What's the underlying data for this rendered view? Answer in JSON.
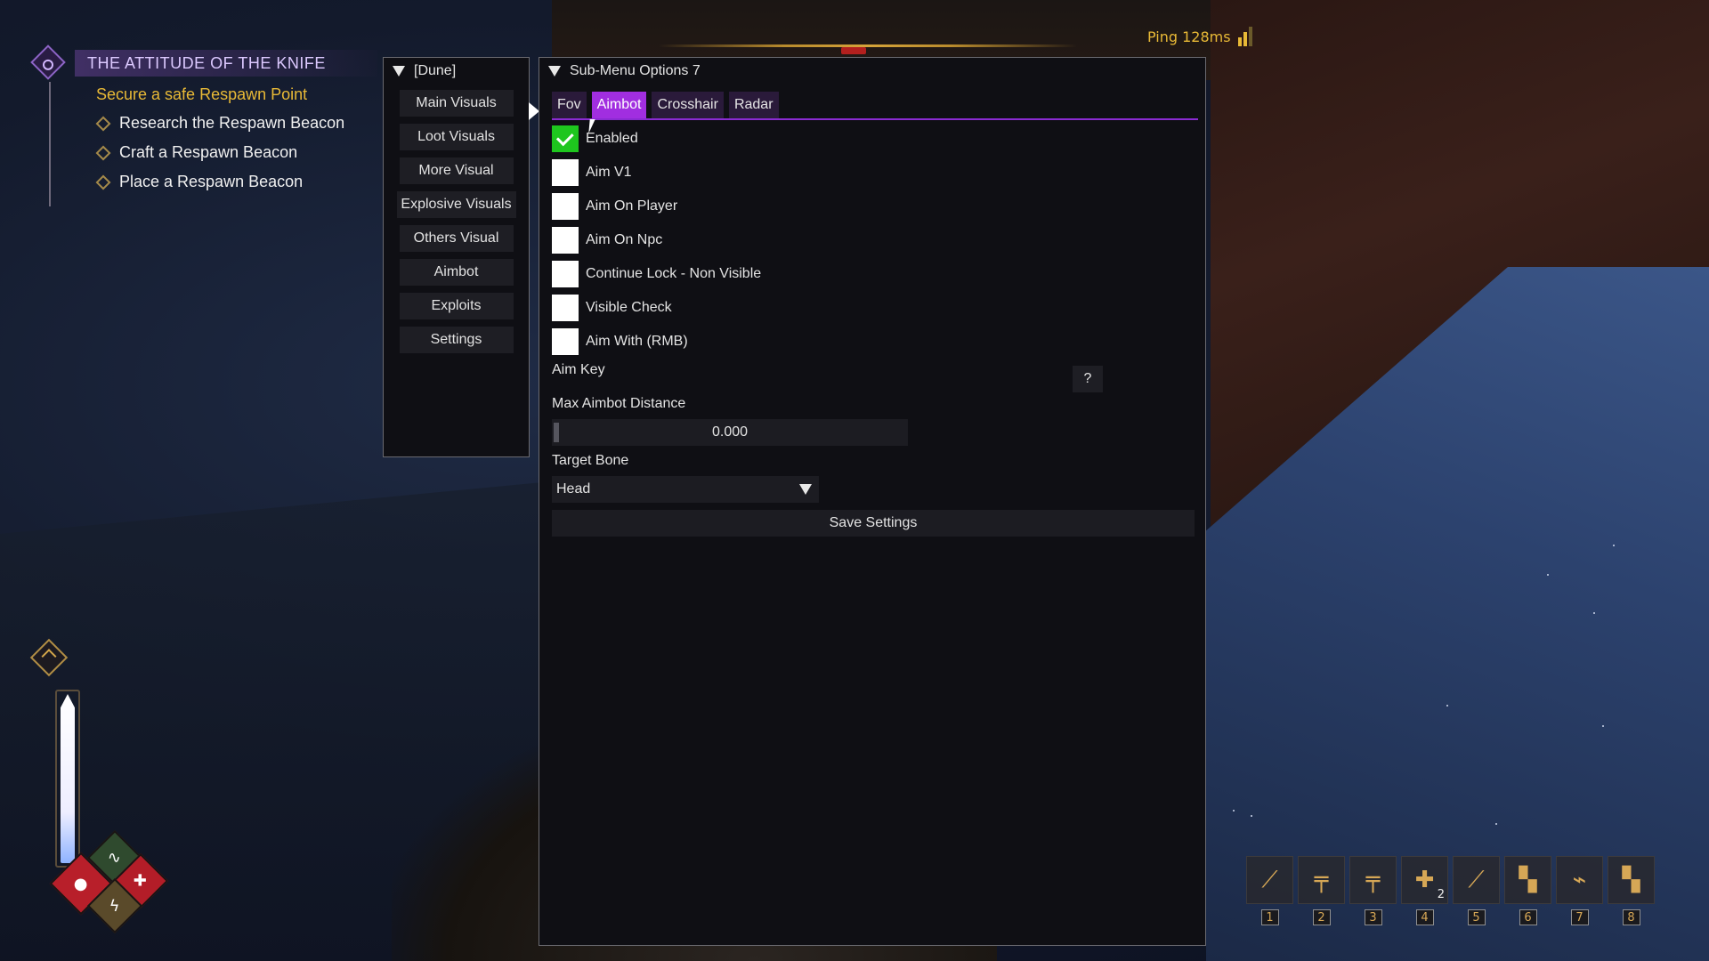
{
  "ping": {
    "label": "Ping 128ms"
  },
  "quest": {
    "title": "THE ATTITUDE OF THE KNIFE",
    "subtitle": "Secure a safe Respawn Point",
    "tasks": [
      "Research the Respawn Beacon",
      "Craft a Respawn Beacon",
      "Place a Respawn Beacon"
    ]
  },
  "nav_window": {
    "title": "[Dune]",
    "items": [
      "Main Visuals",
      "Loot Visuals",
      "More Visual",
      "Explosive Visuals",
      "Others Visual",
      "Aimbot",
      "Exploits",
      "Settings"
    ]
  },
  "sub_window": {
    "title": "Sub-Menu Options 7",
    "tabs": [
      "Fov",
      "Aimbot",
      "Crosshair",
      "Radar"
    ],
    "active_tab": "Aimbot",
    "checkboxes": [
      {
        "label": "Enabled",
        "checked": true
      },
      {
        "label": "Aim V1",
        "checked": false
      },
      {
        "label": "Aim On Player",
        "checked": false
      },
      {
        "label": "Aim On Npc",
        "checked": false
      },
      {
        "label": "Continue Lock - Non Visible",
        "checked": false
      },
      {
        "label": "Visible Check",
        "checked": false
      },
      {
        "label": "Aim With (RMB)",
        "checked": false
      }
    ],
    "aim_key": {
      "label": "Aim Key",
      "value": "?"
    },
    "max_distance": {
      "label": "Max Aimbot Distance",
      "value": "0.000"
    },
    "target_bone": {
      "label": "Target Bone",
      "value": "Head"
    },
    "save_label": "Save Settings"
  },
  "hotbar": {
    "slots": [
      {
        "num": "1",
        "icon": "knife-icon",
        "count": ""
      },
      {
        "num": "2",
        "icon": "pistol-icon",
        "count": ""
      },
      {
        "num": "3",
        "icon": "rifle-icon",
        "count": ""
      },
      {
        "num": "4",
        "icon": "medkit-icon",
        "count": "2"
      },
      {
        "num": "5",
        "icon": "blade-icon",
        "count": ""
      },
      {
        "num": "6",
        "icon": "cutter-tool-icon",
        "count": ""
      },
      {
        "num": "7",
        "icon": "flashlight-icon",
        "count": ""
      },
      {
        "num": "8",
        "icon": "welder-tool-icon",
        "count": ""
      }
    ]
  },
  "colors": {
    "accent": "#a12ee0",
    "check_on": "#1ec61e",
    "gold": "#e8b936"
  }
}
